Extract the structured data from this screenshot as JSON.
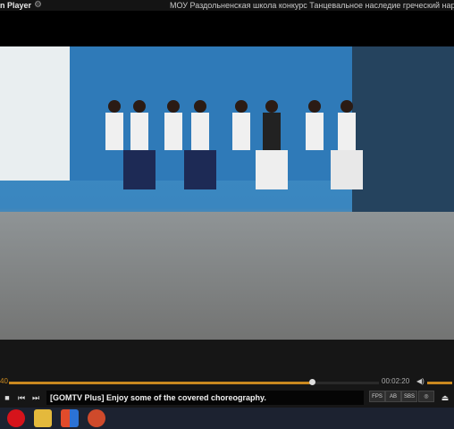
{
  "titlebar": {
    "app_name": "n Player",
    "video_title": "МОУ Раздольненская школа конкурс Танцевальное наследие  греческий народный танец"
  },
  "player": {
    "time_elapsed": "40",
    "time_total": "00:02:20",
    "progress_fraction": 0.82,
    "volume_fraction": 1.0,
    "message": "[GOMTV Plus] Enjoy some of the covered choreography.",
    "buttons": [
      "stop",
      "previous",
      "next"
    ],
    "small_buttons": [
      "FPS",
      "A-B",
      "SBS",
      "cam",
      "eject"
    ]
  },
  "icons": {
    "gear": "gear-icon",
    "volume": "speaker-icon",
    "stop": "stop-icon",
    "prev": "previous-icon",
    "next": "next-icon"
  },
  "taskbar": {
    "items": [
      "opera-icon",
      "folder-icon",
      "windows-icon",
      "gom-icon"
    ]
  }
}
